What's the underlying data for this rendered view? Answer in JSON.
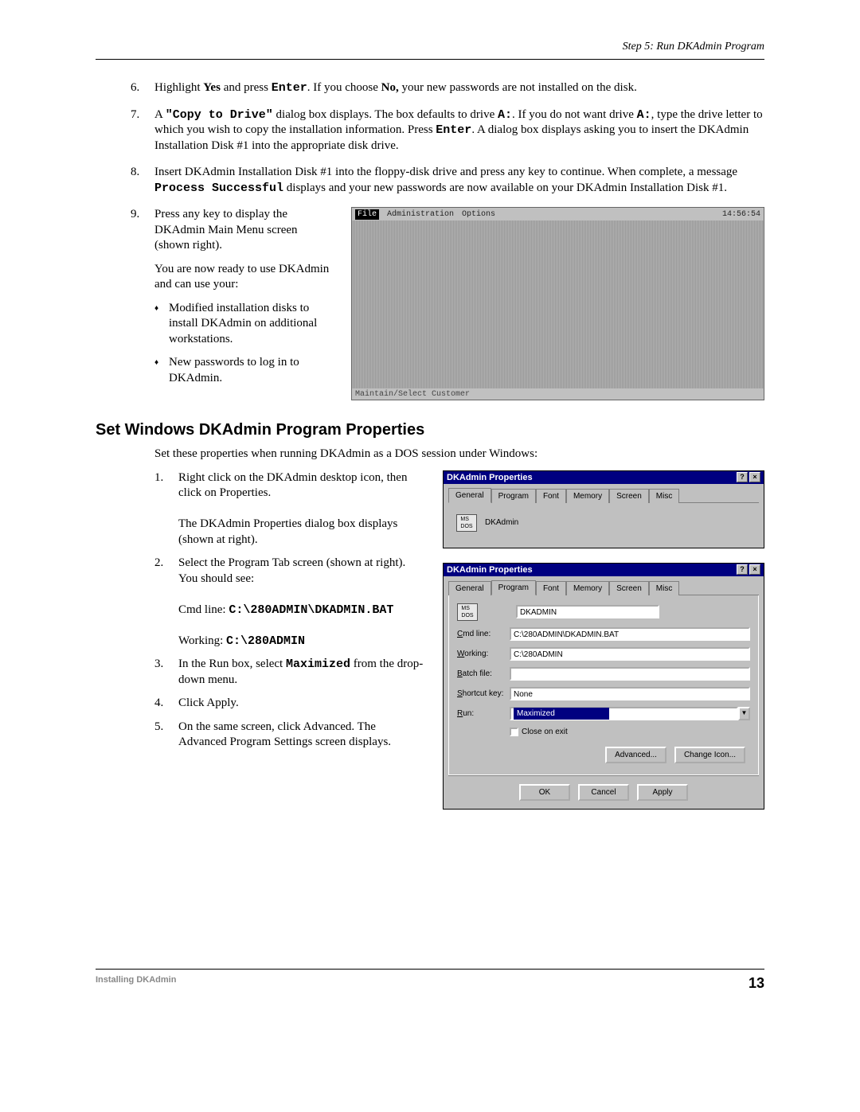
{
  "header": {
    "step_label": "Step 5:  Run DKAdmin Program"
  },
  "steps_cont": [
    {
      "n": "6.",
      "html": "Highlight <b>Yes</b> and press <span class='mono'>Enter</span>. If you choose <b>No,</b> your new passwords are not installed on the disk."
    },
    {
      "n": "7.",
      "html": "A <span class='mono'>\"Copy to Drive\"</span> dialog box displays. The box defaults to drive <span class='mono'>A:</span>. If you do not want drive <span class='mono'>A:</span>, type the drive letter to which you wish to copy the installation information. Press <span class='mono'>Enter</span>. A dialog box displays asking you to insert the DKAdmin Installation Disk #1 into the appropriate disk drive."
    },
    {
      "n": "8.",
      "html": "Insert DKAdmin Installation Disk #1 into the floppy-disk drive and press any key to continue. When complete, a message <span class='mono'>Process Successful</span> displays and your new passwords are now available on your DKAdmin Installation Disk #1."
    }
  ],
  "step9": {
    "n": "9.",
    "para1": "Press any key to display the DKAdmin Main Menu screen (shown right).",
    "para2": "You are now ready to use DKAdmin and can use your:",
    "bullets": [
      "Modified installation disks to install DKAdmin on additional workstations.",
      "New passwords to log in to DKAdmin."
    ],
    "dos": {
      "file": "File",
      "admin": "Administration",
      "options": "Options",
      "time": "14:56:54",
      "footer": "Maintain/Select Customer"
    }
  },
  "section": {
    "title": "Set Windows DKAdmin Program Properties",
    "intro": "Set these properties when running DKAdmin as a DOS session under Windows:"
  },
  "steps2": [
    {
      "n": "1.",
      "html": "Right click on the DKAdmin desktop icon, then click on Properties.<br><br>The DKAdmin Properties dialog box displays (shown at right)."
    },
    {
      "n": "2.",
      "html": "Select the Program Tab screen (shown at right). You should see:<br><br>Cmd line: <span class='mono'>C:\\280ADMIN\\DKADMIN.BAT</span><br><br>Working: <span class='mono'>C:\\280ADMIN</span>"
    },
    {
      "n": "3.",
      "html": "In the Run box, select <span class='mono'>Maximized</span> from the drop-down menu."
    },
    {
      "n": "4.",
      "html": "Click Apply."
    },
    {
      "n": "5.",
      "html": "On the same screen, click Advanced. The Advanced Program Settings screen displays."
    }
  ],
  "dialog1": {
    "title": "DKAdmin Properties",
    "tabs": [
      "General",
      "Program",
      "Font",
      "Memory",
      "Screen",
      "Misc"
    ],
    "active_tab": 0,
    "name": "DKAdmin"
  },
  "dialog2": {
    "title": "DKAdmin Properties",
    "tabs": [
      "General",
      "Program",
      "Font",
      "Memory",
      "Screen",
      "Misc"
    ],
    "active_tab": 1,
    "name": "DKADMIN",
    "fields": {
      "cmdline_label": "Cmd line:",
      "cmdline": "C:\\280ADMIN\\DKADMIN.BAT",
      "working_label": "Working:",
      "working": "C:\\280ADMIN",
      "batch_label": "Batch file:",
      "batch": "",
      "shortcut_label": "Shortcut key:",
      "shortcut": "None",
      "run_label": "Run:",
      "run": "Maximized",
      "close_on_exit": "Close on exit"
    },
    "buttons": {
      "advanced": "Advanced...",
      "change_icon": "Change Icon...",
      "ok": "OK",
      "cancel": "Cancel",
      "apply": "Apply"
    }
  },
  "footer": {
    "left": "Installing DKAdmin",
    "right": "13"
  }
}
